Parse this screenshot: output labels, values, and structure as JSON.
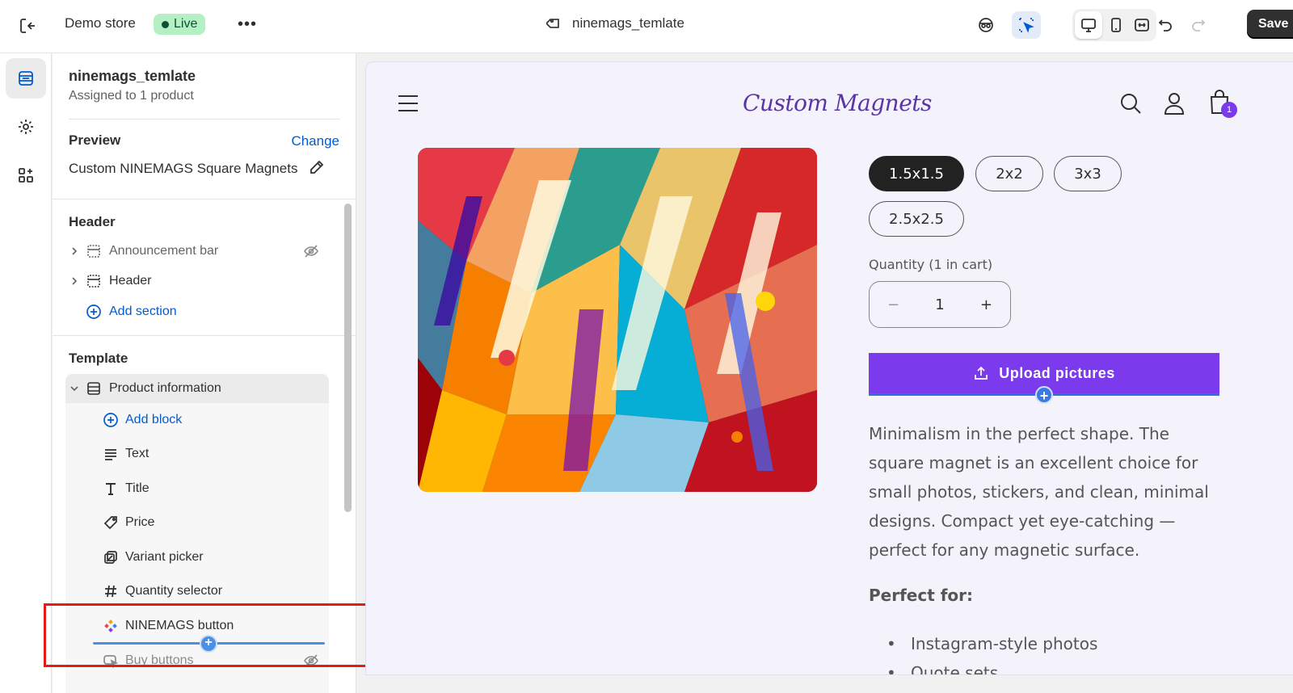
{
  "topbar": {
    "store_name": "Demo store",
    "live_label": "Live",
    "more_label": "•••",
    "template_name": "ninemags_temlate",
    "save_label": "Save"
  },
  "sidebar": {
    "title": "ninemags_temlate",
    "subtitle": "Assigned to 1 product",
    "preview_label": "Preview",
    "change_label": "Change",
    "preview_product": "Custom NINEMAGS Square Magnets",
    "header_heading": "Header",
    "header_items": [
      {
        "label": "Announcement bar",
        "hidden": true
      },
      {
        "label": "Header",
        "hidden": false
      }
    ],
    "add_section_label": "Add section",
    "template_heading": "Template",
    "product_info_label": "Product information",
    "add_block_label": "Add block",
    "blocks": [
      {
        "label": "Text",
        "icon": "text-lines-icon"
      },
      {
        "label": "Title",
        "icon": "title-t-icon"
      },
      {
        "label": "Price",
        "icon": "price-tag-icon"
      },
      {
        "label": "Variant picker",
        "icon": "variant-picker-icon"
      },
      {
        "label": "Quantity selector",
        "icon": "hash-icon"
      },
      {
        "label": "NINEMAGS button",
        "icon": "ninemags-app-icon"
      },
      {
        "label": "Buy buttons",
        "icon": "buy-buttons-icon",
        "hidden": true
      }
    ]
  },
  "preview": {
    "logo_text": "Custom Magnets",
    "cart_count": "1",
    "sizes": [
      "1.5x1.5",
      "2x2",
      "3x3",
      "2.5x2.5"
    ],
    "selected_size": "1.5x1.5",
    "quantity_label": "Quantity (1 in cart)",
    "quantity_value": "1",
    "upload_label": "Upload pictures",
    "description": "Minimalism in the perfect shape. The square magnet is an excellent choice for small photos, stickers, and clean, minimal designs. Compact yet eye-catching — perfect for any magnetic surface.",
    "perfect_for_heading": "Perfect for:",
    "perfect_for": [
      "Instagram-style photos",
      "Quote sets"
    ]
  },
  "colors": {
    "accent_purple": "#7c3aed",
    "live_green": "#b4f0c4",
    "link_blue": "#005bd3",
    "highlight_red": "#e41b17"
  }
}
